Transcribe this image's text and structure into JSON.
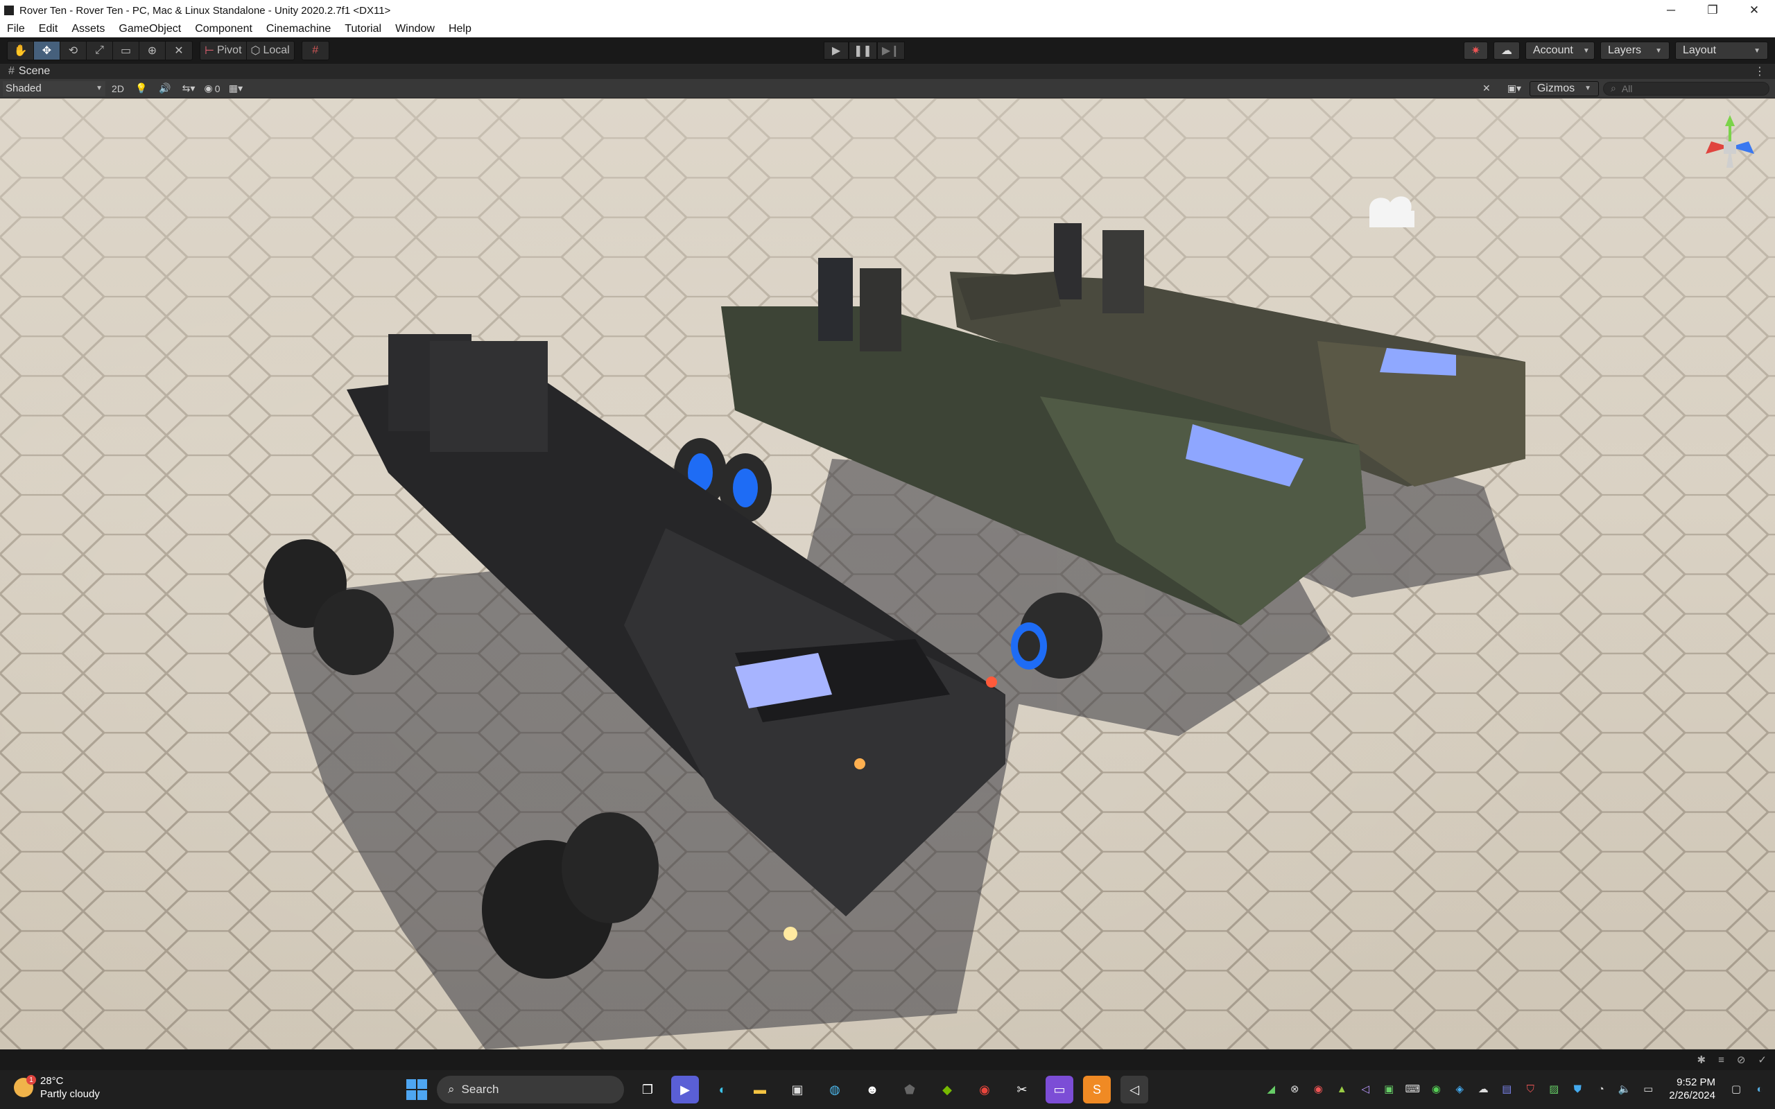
{
  "window": {
    "title": "Rover Ten - Rover Ten - PC, Mac & Linux Standalone - Unity 2020.2.7f1 <DX11>",
    "minimize": "─",
    "restore": "❐",
    "close": "✕"
  },
  "menu": [
    "File",
    "Edit",
    "Assets",
    "GameObject",
    "Component",
    "Cinemachine",
    "Tutorial",
    "Window",
    "Help"
  ],
  "toolbar": {
    "pivot": "Pivot",
    "local": "Local",
    "account": "Account",
    "layers": "Layers",
    "layout": "Layout"
  },
  "scene": {
    "tab_label": "Scene",
    "shading": "Shaded",
    "mode_2d": "2D",
    "hidden_count": "0",
    "gizmos": "Gizmos",
    "search_placeholder": "All"
  },
  "taskbar": {
    "temperature": "28°C",
    "weather": "Partly cloudy",
    "notification_count": "1",
    "search": "Search",
    "time": "9:52 PM",
    "date": "2/26/2024"
  },
  "colors": {
    "editor_bg": "#191919",
    "active_tool": "#46607c",
    "ground": "#d8d0c2",
    "accent_blue": "#2d6cf0"
  }
}
